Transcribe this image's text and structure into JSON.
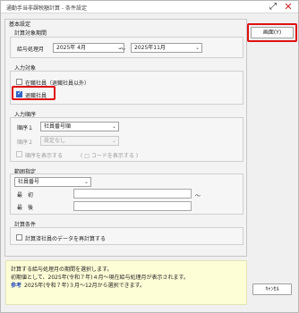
{
  "window": {
    "title": "通勤手当非課税額計算 - 条件設定",
    "expand_glyph": "⤢",
    "close_glyph": "✕"
  },
  "outer": {
    "caption": "基本設定"
  },
  "period": {
    "title": "計算対象期間",
    "label": "給与処理月",
    "from": "2025年 4月",
    "separator": "～",
    "to": "2025年11月"
  },
  "target": {
    "title": "入力対象",
    "opt_employed": "在職社員（退職社員以外）",
    "opt_employed_checked": false,
    "opt_retired": "退職社員",
    "opt_retired_checked": true
  },
  "order": {
    "title": "入力順序",
    "order1_label": "順序１",
    "order1_value": "社員番号順",
    "order2_label": "順序２",
    "order2_value": "設定なし",
    "show_order_label": "順序を表示する",
    "show_code_label": "( □ コードを表示する )"
  },
  "range": {
    "title": "範囲指定",
    "field": "社員番号",
    "first_label": "最　初",
    "last_label": "最　後",
    "tilde": "～"
  },
  "calc": {
    "title": "計算条件",
    "recalc_label": "計算済社員のデータを再計算する",
    "recalc_checked": false
  },
  "buttons": {
    "ok": "画面(Y)",
    "cancel": "ｷｬﾝｾﾙ"
  },
  "info": {
    "line1": "計算する給与処理月の期間を選択します。",
    "line2": "初期値として、2025年(令和７年)４月～現在給与処理月が表示されます。",
    "ref_label": "参考",
    "line3": "2025年(令和７年)３月～12月から選択できます。"
  },
  "colors": {
    "highlight": "#e01010",
    "accent": "#2d64c8",
    "info_bg": "#fdfdd6"
  }
}
